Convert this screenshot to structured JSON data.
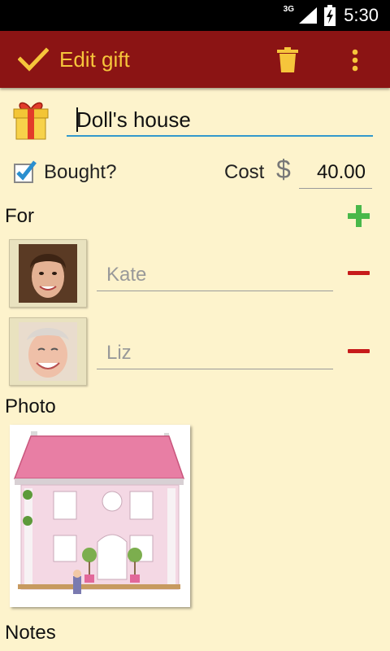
{
  "status_bar": {
    "network": "3G",
    "time": "5:30"
  },
  "app_bar": {
    "title": "Edit gift",
    "icons": [
      "check-icon",
      "trash-icon",
      "overflow-menu-icon"
    ]
  },
  "gift": {
    "name": "Doll's house",
    "bought_label": "Bought?",
    "bought_checked": true,
    "cost_label": "Cost",
    "currency_symbol": "$",
    "cost": "40.00"
  },
  "for_section": {
    "label": "For",
    "people": [
      {
        "name": "Kate"
      },
      {
        "name": "Liz"
      }
    ]
  },
  "photo_section": {
    "label": "Photo"
  },
  "notes_section": {
    "label": "Notes"
  },
  "colors": {
    "app_bar": "#8b1414",
    "accent": "#f6c53b",
    "background": "#fdf3cc",
    "add": "#49b84a",
    "remove": "#c71a1a",
    "focus_underline": "#3399cc"
  }
}
